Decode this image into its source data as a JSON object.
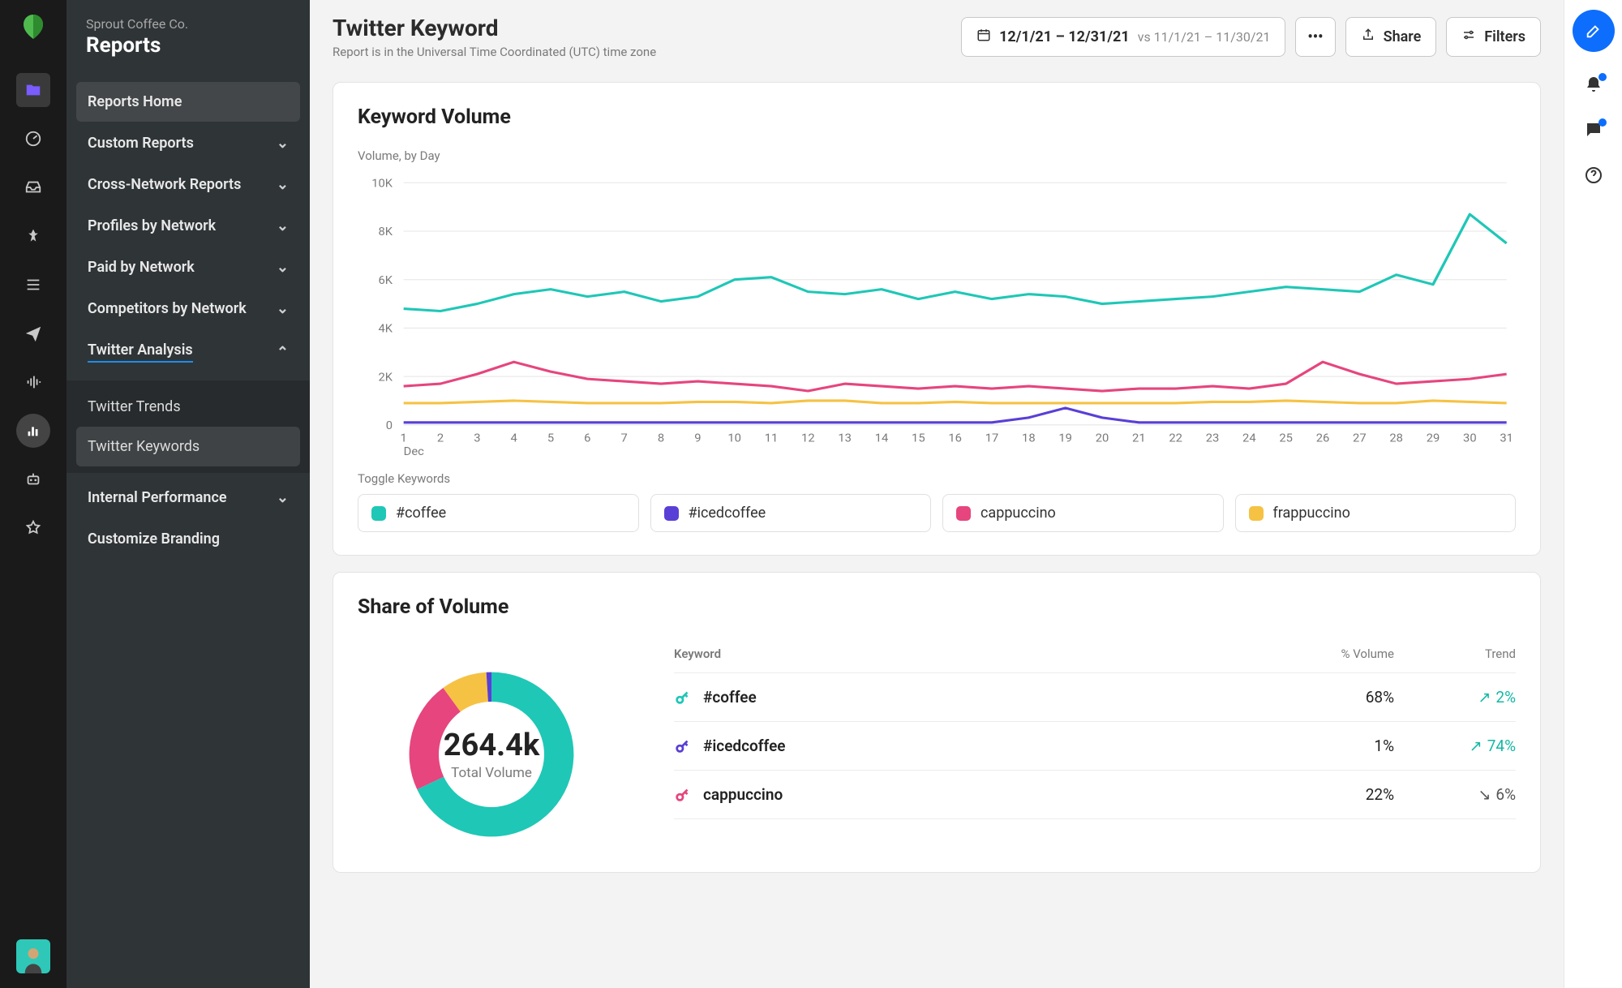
{
  "org": "Sprout Coffee Co.",
  "section_title": "Reports",
  "sidebar": {
    "home": "Reports Home",
    "items": [
      {
        "label": "Custom Reports"
      },
      {
        "label": "Cross-Network Reports"
      },
      {
        "label": "Profiles by Network"
      },
      {
        "label": "Paid by Network"
      },
      {
        "label": "Competitors by Network"
      },
      {
        "label": "Twitter Analysis",
        "expanded": true
      }
    ],
    "sub": [
      {
        "label": "Twitter Trends"
      },
      {
        "label": "Twitter Keywords",
        "selected": true
      }
    ],
    "after": [
      {
        "label": "Internal Performance",
        "chev": true
      },
      {
        "label": "Customize Branding",
        "chev": false
      }
    ]
  },
  "page": {
    "title": "Twitter Keyword",
    "tz": "Report is in the Universal Time Coordinated (UTC) time zone"
  },
  "toolbar": {
    "date_range": "12/1/21 – 12/31/21",
    "date_vs": "vs 11/1/21 – 11/30/21",
    "share": "Share",
    "filters": "Filters"
  },
  "volume_card": {
    "title": "Keyword Volume",
    "subtitle": "Volume, by Day",
    "toggle_label": "Toggle Keywords"
  },
  "legend": [
    {
      "label": "#coffee",
      "color": "#1fc7b6"
    },
    {
      "label": "#icedcoffee",
      "color": "#5a3fd6"
    },
    {
      "label": "cappuccino",
      "color": "#e6457e"
    },
    {
      "label": "frappuccino",
      "color": "#f6c244"
    }
  ],
  "share_card": {
    "title": "Share of Volume",
    "total_value": "264.4k",
    "total_label": "Total Volume",
    "columns": {
      "keyword": "Keyword",
      "volume": "% Volume",
      "trend": "Trend"
    },
    "rows": [
      {
        "color": "#1fc7b6",
        "keyword": "#coffee",
        "volume": "68%",
        "trend": "2%",
        "dir": "up"
      },
      {
        "color": "#5a3fd6",
        "keyword": "#icedcoffee",
        "volume": "1%",
        "trend": "74%",
        "dir": "up"
      },
      {
        "color": "#e6457e",
        "keyword": "cappuccino",
        "volume": "22%",
        "trend": "6%",
        "dir": "down"
      }
    ]
  },
  "chart_data": {
    "type": "line",
    "title": "Keyword Volume",
    "subtitle": "Volume, by Day",
    "xlabel": "Dec",
    "ylabel": "",
    "ylim": [
      0,
      10000
    ],
    "y_ticks": [
      "0",
      "2K",
      "4K",
      "6K",
      "8K",
      "10K"
    ],
    "x": [
      1,
      2,
      3,
      4,
      5,
      6,
      7,
      8,
      9,
      10,
      11,
      12,
      13,
      14,
      15,
      16,
      17,
      18,
      19,
      20,
      21,
      22,
      23,
      24,
      25,
      26,
      27,
      28,
      29,
      30,
      31
    ],
    "month_label": "Dec",
    "series": [
      {
        "name": "#coffee",
        "color": "#1fc7b6",
        "values": [
          4800,
          4700,
          5000,
          5400,
          5600,
          5300,
          5500,
          5100,
          5300,
          6000,
          6100,
          5500,
          5400,
          5600,
          5200,
          5500,
          5200,
          5400,
          5300,
          5000,
          5100,
          5200,
          5300,
          5500,
          5700,
          5600,
          5500,
          6200,
          5800,
          8700,
          7500
        ]
      },
      {
        "name": "#icedcoffee",
        "color": "#5a3fd6",
        "values": [
          100,
          100,
          100,
          100,
          100,
          100,
          100,
          100,
          100,
          100,
          100,
          100,
          100,
          100,
          100,
          100,
          100,
          300,
          700,
          300,
          100,
          100,
          100,
          100,
          100,
          100,
          100,
          100,
          100,
          100,
          100
        ]
      },
      {
        "name": "cappuccino",
        "color": "#e6457e",
        "values": [
          1600,
          1700,
          2100,
          2600,
          2200,
          1900,
          1800,
          1700,
          1800,
          1700,
          1600,
          1400,
          1700,
          1600,
          1500,
          1600,
          1500,
          1600,
          1500,
          1400,
          1500,
          1500,
          1600,
          1500,
          1700,
          2600,
          2100,
          1700,
          1800,
          1900,
          2100
        ]
      },
      {
        "name": "frappuccino",
        "color": "#f6c244",
        "values": [
          900,
          900,
          950,
          1000,
          950,
          900,
          900,
          900,
          950,
          950,
          900,
          1000,
          1000,
          900,
          900,
          950,
          900,
          900,
          900,
          900,
          900,
          900,
          950,
          950,
          1000,
          950,
          900,
          900,
          1000,
          950,
          900
        ]
      }
    ]
  },
  "donut_data": {
    "type": "pie",
    "total": "264.4k",
    "slices": [
      {
        "name": "#coffee",
        "value": 68,
        "color": "#1fc7b6"
      },
      {
        "name": "cappuccino",
        "value": 22,
        "color": "#e6457e"
      },
      {
        "name": "frappuccino",
        "value": 9,
        "color": "#f6c244"
      },
      {
        "name": "#icedcoffee",
        "value": 1,
        "color": "#5a3fd6"
      }
    ]
  }
}
